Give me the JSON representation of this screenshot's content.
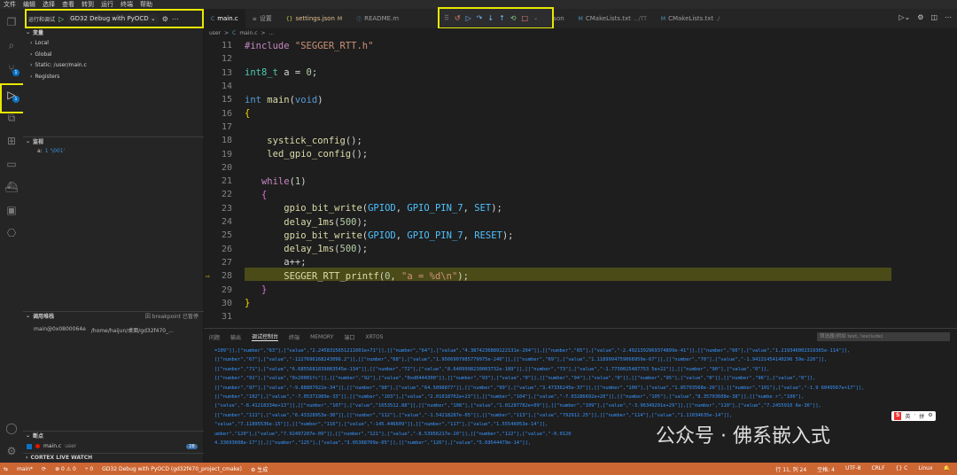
{
  "menubar": [
    "文件",
    "编辑",
    "选择",
    "查看",
    "转到",
    "运行",
    "终端",
    "帮助"
  ],
  "debug_toolbar": {
    "label": "运行和调试",
    "config": "GD32 Debug with PyOCD"
  },
  "sidebar": {
    "variables_title": "变量",
    "scopes": [
      "Local",
      "Global",
      "Static: /user/main.c",
      "Registers"
    ],
    "watch_title": "监视",
    "watch_item": {
      "name": "a:",
      "value": "1 '\\001'"
    },
    "callstack_title": "调用堆栈",
    "callstack_hint": "因 breakpoint 已暂停",
    "callstack_frame": {
      "addr": "main@0x0800064e",
      "path": "/home/haijun/桌面/gd32f470_..."
    },
    "breakpoints_title": "断点",
    "breakpoint_item": {
      "file": "main.c",
      "dir": "user",
      "count": "28"
    },
    "live_watch_title": "CORTEX LIVE WATCH"
  },
  "tabs": [
    {
      "label": "main.c",
      "icon": "C",
      "active": true
    },
    {
      "label": "设置",
      "icon": "≡"
    },
    {
      "label": "settings.json",
      "icon": "{}",
      "mark": "M"
    },
    {
      "label": "README.m",
      "icon": "ⓘ"
    },
    {
      "label": "launch.json",
      "icon": "{}"
    },
    {
      "label": "CMakeLists.txt",
      "icon": "M",
      "dim": ".../TT"
    },
    {
      "label": "CMakeLists.txt",
      "icon": "M",
      "dim": "./"
    }
  ],
  "breadcrumb": [
    "user",
    ">",
    "C",
    "main.c",
    ">",
    "..."
  ],
  "code_lines": [
    {
      "n": "11"
    },
    {
      "n": "12"
    },
    {
      "n": "13"
    },
    {
      "n": "14"
    },
    {
      "n": "15"
    },
    {
      "n": "16"
    },
    {
      "n": "17"
    },
    {
      "n": "18"
    },
    {
      "n": "19"
    },
    {
      "n": "20"
    },
    {
      "n": "21"
    },
    {
      "n": "22"
    },
    {
      "n": "23"
    },
    {
      "n": "24"
    },
    {
      "n": "25"
    },
    {
      "n": "26"
    },
    {
      "n": "27"
    },
    {
      "n": "28"
    },
    {
      "n": "29"
    },
    {
      "n": "30"
    },
    {
      "n": "31"
    }
  ],
  "panel": {
    "tabs": [
      "问题",
      "输出",
      "调试控制台",
      "终端",
      "MEMORY",
      "端口",
      "XRTOS"
    ],
    "active_tab": "调试控制台",
    "filter_placeholder": "筛选器(例如 text, !exclude)",
    "console_lines": [
      "=109\"]],[\"number\",\"63\"],[\"value\",\"2.2458315651211601e+71\"]],[[\"number\",\"64\"],[\"value\",\"4.3874236889122131e-204\"]],[[\"number\",\"65\"],[\"value\",\"-2.4921392969374899e-41\"]],[[\"number\",\"66\"],[\"value\",\"1.219346002319365e-114\"]],",
      "[[\"number\",\"67\"],[\"value\",\"-1227696168243096.2\"]],[[\"number\",\"68\"],[\"value\",\"1.9566907985779975e-240\"]],[[\"number\",\"69\"],[\"value\",\"1.1189994759066959e-67\"]],[[\"number\",\"70\"],[\"value\",\"-1.94131454140296 59e-220\"]],",
      "[[\"number\",\"71\"],[\"value\",\"6.6855681839083545e-134\"]],[[\"number\",\"72\"],[\"value\",\"8.6409998230003732e-189\"]],[[\"number\",\"73\"],[\"value\",\"-1.7730025487753 5e+22\"]],[[\"number\",\"90\"],[\"value\",\"0\"]],",
      "[[\"number\",\"91\"],[\"value\",\"0x20001fc\"]],[[\"number\",\"92\"],[\"value\",\"0xd0444300\"]],[[\"number\",\"93\"],[\"value\",\"0\"]],[[\"number\",\"94\"],[\"value\",\"0\"]],[[\"number\",\"95\"],[\"value\",\"0\"]],[[\"number\",\"96\"],[\"value\",\"0\"]],",
      "[[\"number\",\"97\"],[\"value\",\"-9.88807922e-34\"]],[[\"number\",\"98\"],[\"value\",\"64.5098877\"]],[[\"number\",\"99\"],[\"value\",\"3.47336245e-37\"]],[[\"number\",\"100\"],[\"value\",\"1.85793568e-26\"]],[[\"number\",\"101\"],[\"value\",\"-1.9 6049567e+17\"]],",
      "[[\"number\",\"102\"],[\"value\",\"-7.05371989e-33\"]],[[\"number\",\"103\"],[\"value\",\"2.01018702e+23\"]],[[\"number\",\"104\"],[\"value\",\"-7.03286692e+20\"]],[[\"number\",\"105\"],[\"value\",\"8.35703608e-38\"]],[[\"numbe r\",\"106\"],",
      "[\"value\",\"-8.41218334e+13\"]],[[\"number\",\"107\"],[\"value\",\"1653512.88\"]],[[\"number\",\"108\"],[\"value\",\"1.01287782e+09\"]],[[\"number\",\"109\"],[\"value\",\"-3.96349291e+29\"]],[[\"number\",\"110\"],[\"value\",\"7.2455910 6e-36\"]],",
      "[[\"number\",\"111\"],[\"value\",\"6.43328953e-30\"]],[[\"number\",\"112\"],[\"value\",\"-1.54218287e-05\"]],[[\"number\",\"113\"],[\"value\",\"792912.25\"]],[[\"number\",\"114\"],[\"value\",\"1.11034635e-14\"]],",
      "\"value\",\"7.11895536e-15\"]],[[\"number\",\"116\"],[\"value\",\"-145.446609\"]],[[\"number\",\"117\"],[\"value\",\"1.55546053e-14\"]],",
      "umber\",\"120\"],[\"value\",\"7.92497207e-09\"]],[[\"number\",\"121\"],[\"value\",\"-8.53956217e-20\"]],[[\"number\",\"122\"],[\"value\",\"-0.0120",
      "4.33693608e-17\"]],[[\"number\",\"125\"],[\"value\",\"3.05388709e-05\"]],[[\"number\",\"126\"],[\"value\",\"5.69544479e-14\"]],"
    ]
  },
  "statusbar": {
    "branch": "main*",
    "sync": "⟳",
    "errors": "⊗ 0 ⚠ 0",
    "ports": "⑂ 0",
    "debug": "GD32 Debug with PyOCD (gd32f470_project_cmake)",
    "build": "⚙ 生成",
    "position": "行 11, 列 24",
    "spaces": "空格: 4",
    "encoding": "UTF-8",
    "eol": "CRLF",
    "lang": "{} C",
    "os": "Linux"
  },
  "watermark": "公众号 · 佛系嵌入式",
  "ime": {
    "logo": "S",
    "items": [
      "英",
      "·",
      "拼",
      "⚙"
    ]
  },
  "colors": {
    "accent": "#0a72c5",
    "statusbar": "#cc6633",
    "highlight_box": "#e8e800",
    "current_line": "#4b4b18"
  }
}
